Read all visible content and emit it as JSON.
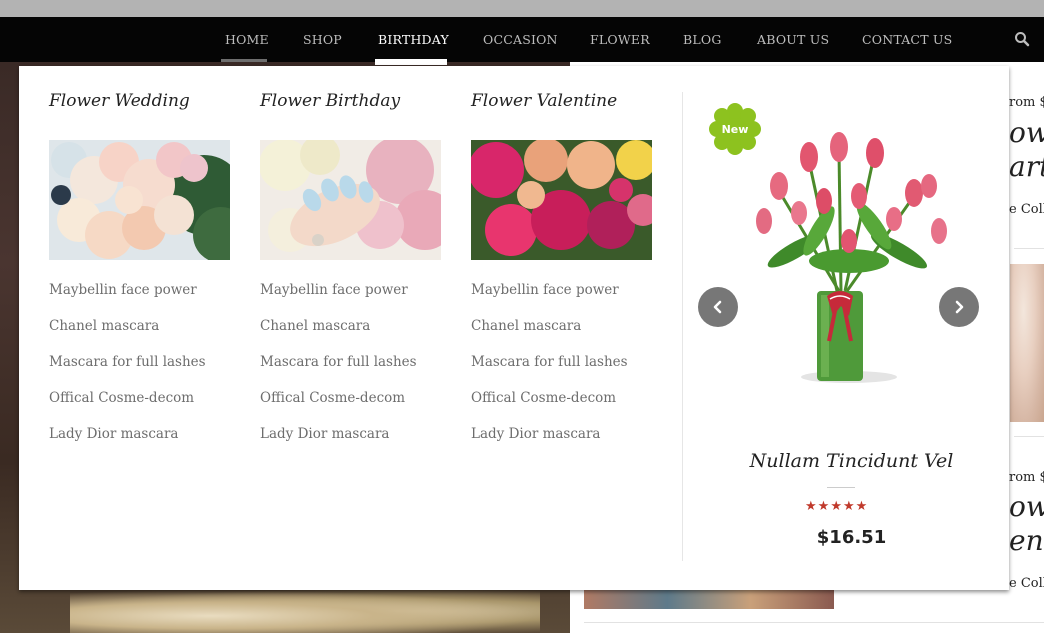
{
  "nav": {
    "items": [
      {
        "label": "HOME"
      },
      {
        "label": "SHOP"
      },
      {
        "label": "BIRTHDAY"
      },
      {
        "label": "OCCASION"
      },
      {
        "label": "FLOWER"
      },
      {
        "label": "BLOG"
      },
      {
        "label": "ABOUT US"
      },
      {
        "label": "CONTACT US"
      }
    ],
    "active": "BIRTHDAY",
    "search_icon": "search-icon"
  },
  "mega_menu": {
    "columns": [
      {
        "title": "Flower Wedding",
        "links": [
          "Maybellin face power",
          "Chanel mascara",
          "Mascara for full lashes",
          "Offical Cosme-decom",
          "Lady Dior mascara"
        ]
      },
      {
        "title": "Flower Birthday",
        "links": [
          "Maybellin face power",
          "Chanel mascara",
          "Mascara for full lashes",
          "Offical Cosme-decom",
          "Lady Dior mascara"
        ]
      },
      {
        "title": "Flower Valentine",
        "links": [
          "Maybellin face power",
          "Chanel mascara",
          "Mascara for full lashes",
          "Offical Cosme-decom",
          "Lady Dior mascara"
        ]
      }
    ],
    "featured": {
      "badge": "New",
      "title": "Nullam Tincidunt Vel",
      "rating": 5,
      "price": "$16.51",
      "prev_icon": "chevron-left-icon",
      "next_icon": "chevron-right-icon"
    }
  },
  "background": {
    "texts": [
      "rom $",
      "owe",
      "arty",
      "e Coll",
      "rom $",
      "owe",
      "enti",
      "e Coll"
    ]
  },
  "colors": {
    "nav_bg": "#050505",
    "badge": "#8dc21f",
    "star": "#c0392b",
    "link": "#6d6d6d"
  }
}
